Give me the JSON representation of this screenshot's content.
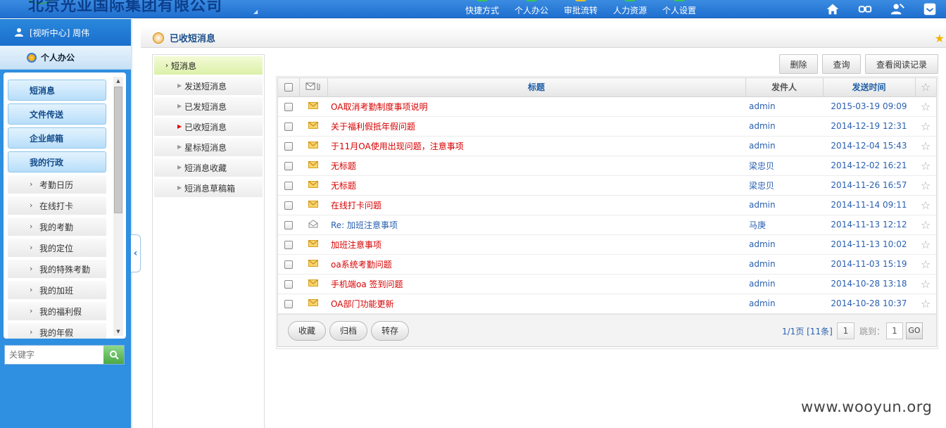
{
  "app": {
    "logo_text": "北京光亚国际集团有限公司"
  },
  "top_nav": [
    {
      "label": "快捷方式"
    },
    {
      "label": "个人办公"
    },
    {
      "label": "审批流转"
    },
    {
      "label": "人力资源"
    },
    {
      "label": "个人设置"
    }
  ],
  "top_icons": [
    "home-icon",
    "grid-icon",
    "user-icon",
    "settings-icon"
  ],
  "sidebar": {
    "user_label": "[视听中心] 周伟",
    "module_label": "个人办公",
    "main_items": [
      {
        "label": "短消息"
      },
      {
        "label": "文件传送"
      },
      {
        "label": "企业邮箱"
      },
      {
        "label": "我的行政"
      }
    ],
    "sub_items": [
      {
        "label": "考勤日历"
      },
      {
        "label": "在线打卡"
      },
      {
        "label": "我的考勤"
      },
      {
        "label": "我的定位"
      },
      {
        "label": "我的特殊考勤"
      },
      {
        "label": "我的加班"
      },
      {
        "label": "我的福利假"
      },
      {
        "label": "我的年假"
      }
    ],
    "search_placeholder": "关键字"
  },
  "page": {
    "title": "已收短消息"
  },
  "subnav": {
    "header": "短消息",
    "items": [
      {
        "label": "发送短消息"
      },
      {
        "label": "已发短消息"
      },
      {
        "label": "已收短消息"
      },
      {
        "label": "星标短消息"
      },
      {
        "label": "短消息收藏"
      },
      {
        "label": "短消息草稿箱"
      }
    ],
    "current": "已收短消息"
  },
  "toolbar": {
    "delete_label": "删除",
    "query_label": "查询",
    "read_records_label": "查看阅读记录"
  },
  "table": {
    "headers": {
      "title": "标题",
      "sender": "发件人",
      "time": "发送时间"
    },
    "rows": [
      {
        "title": "OA取消考勤制度事项说明",
        "sender": "admin",
        "time": "2015-03-19 09:09",
        "read": false
      },
      {
        "title": "关于福利假抵年假问题",
        "sender": "admin",
        "time": "2014-12-19 12:31",
        "read": false
      },
      {
        "title": "于11月OA使用出现问题，注意事项",
        "sender": "admin",
        "time": "2014-12-04 15:43",
        "read": false
      },
      {
        "title": "无标题",
        "sender": "梁忠贝",
        "time": "2014-12-02 16:21",
        "read": false
      },
      {
        "title": "无标题",
        "sender": "梁忠贝",
        "time": "2014-11-26 16:57",
        "read": false
      },
      {
        "title": "在线打卡问题",
        "sender": "admin",
        "time": "2014-11-14 09:11",
        "read": false
      },
      {
        "title": "Re: 加班注意事项",
        "sender": "马庚",
        "time": "2014-11-13 12:12",
        "read": true
      },
      {
        "title": "加班注意事项",
        "sender": "admin",
        "time": "2014-11-13 10:02",
        "read": false
      },
      {
        "title": "oa系统考勤问题",
        "sender": "admin",
        "time": "2014-11-03 15:19",
        "read": false
      },
      {
        "title": "手机端oa 签到问题",
        "sender": "admin",
        "time": "2014-10-28 13:18",
        "read": false
      },
      {
        "title": "OA部门功能更新",
        "sender": "admin",
        "time": "2014-10-28 10:37",
        "read": false
      }
    ]
  },
  "footer": {
    "favorite_label": "收藏",
    "archive_label": "归档",
    "transfer_label": "转存",
    "page_info": "1/1页 [11条]",
    "page_current": "1",
    "jump_label": "跳到：",
    "jump_value": "1",
    "go_label": "GO"
  },
  "watermark": "www.wooyun.org",
  "colors": {
    "unread_title": "#d80000",
    "read_title": "#2a60b0",
    "brand_blue": "#2f8fe0"
  }
}
